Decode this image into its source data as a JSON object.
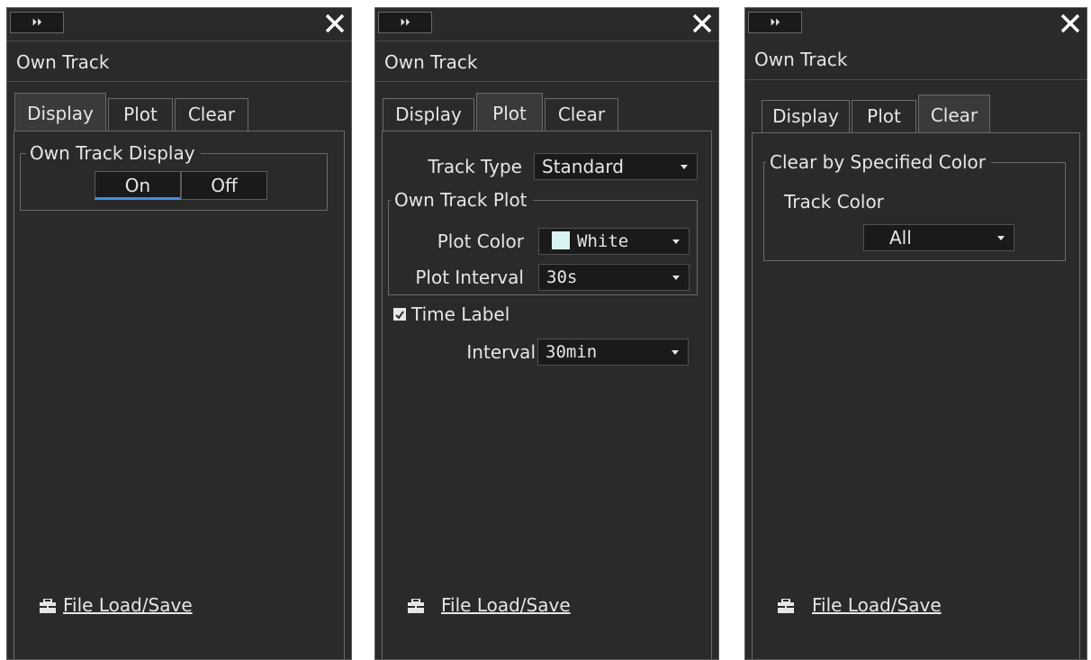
{
  "panels": [
    {
      "expand_label": "⏵⏵",
      "title": "Own Track",
      "tabs": [
        "Display",
        "Plot",
        "Clear"
      ],
      "active_tab": "Display",
      "display": {
        "group_label": "Own Track Display",
        "on_label": "On",
        "off_label": "Off",
        "selected": "On"
      },
      "file_link": "File Load/Save"
    },
    {
      "expand_label": "⏵⏵",
      "title": "Own Track",
      "tabs": [
        "Display",
        "Plot",
        "Clear"
      ],
      "active_tab": "Plot",
      "plot": {
        "track_type_label": "Track Type",
        "track_type_value": "Standard",
        "group_label": "Own Track Plot",
        "plot_color_label": "Plot Color",
        "plot_color_value": "White",
        "plot_color_swatch": "#d9f2f2",
        "plot_interval_label": "Plot Interval",
        "plot_interval_value": "30s",
        "time_label": "Time Label",
        "time_label_checked": true,
        "interval_label": "Interval",
        "interval_value": "30min"
      },
      "file_link": "File Load/Save"
    },
    {
      "expand_label": "⏵⏵",
      "title": "Own Track",
      "tabs": [
        "Display",
        "Plot",
        "Clear"
      ],
      "active_tab": "Clear",
      "clear": {
        "group_label": "Clear by Specified Color",
        "track_color_label": "Track Color",
        "track_color_value": "All"
      },
      "file_link": "File Load/Save"
    }
  ],
  "colors": {
    "panel_bg": "#2a2a2a",
    "field_bg": "#1a1a1a",
    "accent": "#3f8fe0",
    "text": "#e6e6e6"
  },
  "icons": {
    "expand": "double-chevron-right-icon",
    "close": "close-icon",
    "file": "toolbox-icon",
    "check": "checkmark-icon"
  }
}
